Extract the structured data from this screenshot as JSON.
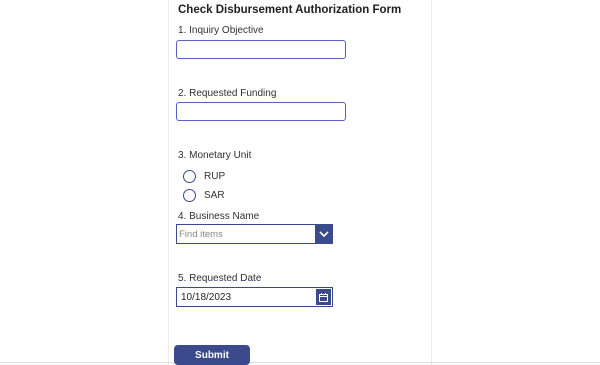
{
  "form": {
    "title": "Check Disbursement Authorization Form",
    "q1": {
      "label": "1. Inquiry Objective",
      "value": ""
    },
    "q2": {
      "label": "2. Requested Funding",
      "value": ""
    },
    "q3": {
      "label": "3. Monetary Unit",
      "options": [
        "RUP",
        "SAR"
      ],
      "selected": null
    },
    "q4": {
      "label": "4. Business Name",
      "placeholder": "Find items"
    },
    "q5": {
      "label": "5. Requested Date",
      "value": "10/18/2023"
    },
    "submit_label": "Submit"
  },
  "icons": {
    "dropdown": "chevron-down-icon",
    "date": "calendar-icon"
  },
  "colors": {
    "accent": "#3b4a8c",
    "input_border": "#5a5fc0"
  }
}
